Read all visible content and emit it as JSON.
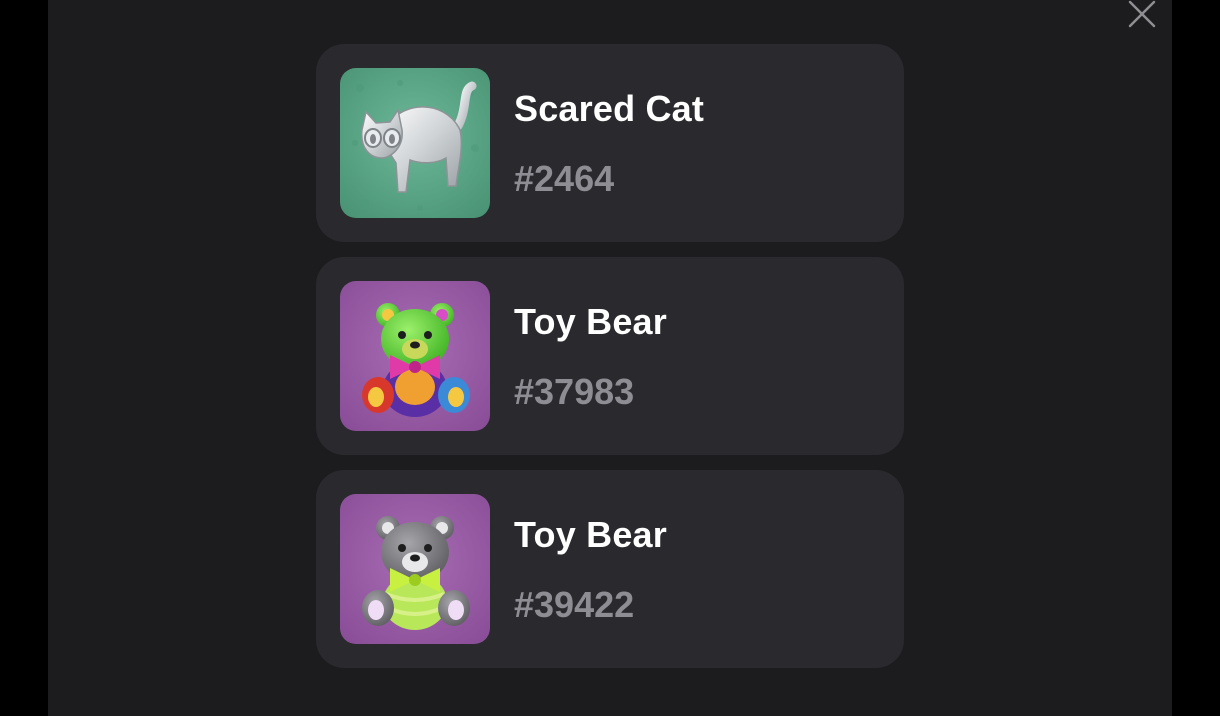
{
  "close_button": {
    "icon": "close-icon",
    "color": "#8e8e93"
  },
  "items": [
    {
      "title": "Scared Cat",
      "number": "#2464",
      "icon": "scared-cat-icon",
      "bg_color": "#5fa888"
    },
    {
      "title": "Toy Bear",
      "number": "#37983",
      "icon": "green-toy-bear-icon",
      "bg_color": "#9a5aa6"
    },
    {
      "title": "Toy Bear",
      "number": "#39422",
      "icon": "gray-toy-bear-icon",
      "bg_color": "#9a5aa6"
    }
  ]
}
